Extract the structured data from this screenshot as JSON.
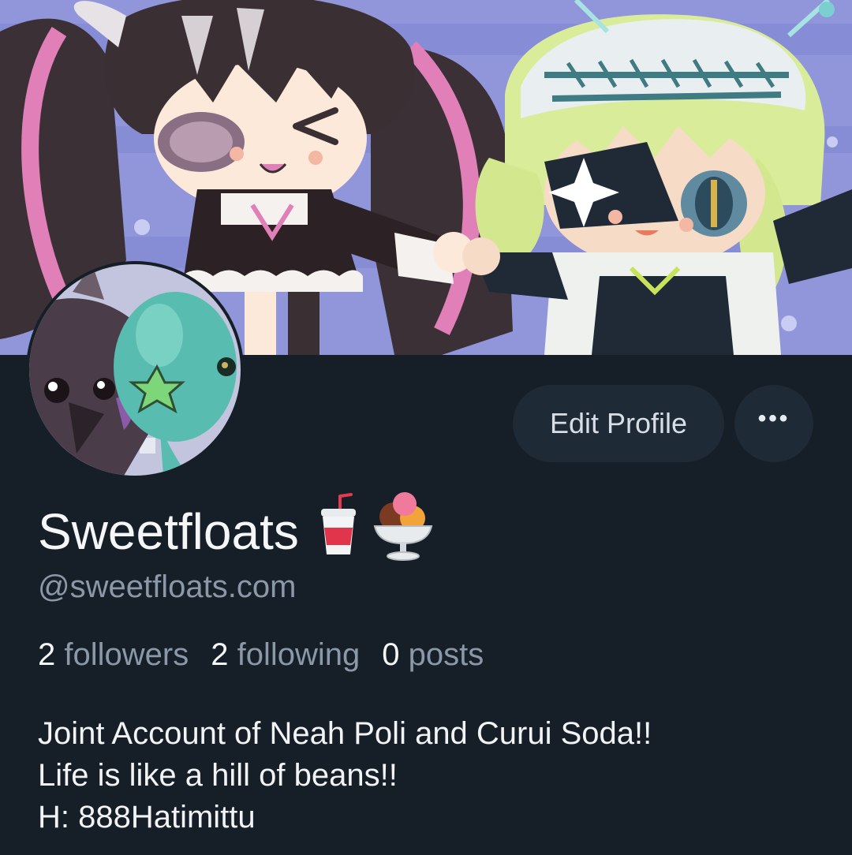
{
  "profile": {
    "display_name": "Sweetfloats",
    "display_name_emoji": [
      "soda-cup",
      "ice-cream-sundae"
    ],
    "handle": "@sweetfloats.com",
    "stats": {
      "followers_count": "2",
      "followers_label": "followers",
      "following_count": "2",
      "following_label": "following",
      "posts_count": "0",
      "posts_label": "posts"
    },
    "bio_lines": [
      "Joint Account of Neah Poli and Curui Soda!!",
      "Life is like a hill of beans!!",
      "H: 888Hatimittu"
    ]
  },
  "actions": {
    "edit_profile_label": "Edit Profile",
    "more_label": "•••"
  },
  "colors": {
    "background": "#161e27",
    "button_bg": "#1e2a36",
    "muted_text": "#8a98a8",
    "banner_bg": "#8f93d9"
  }
}
